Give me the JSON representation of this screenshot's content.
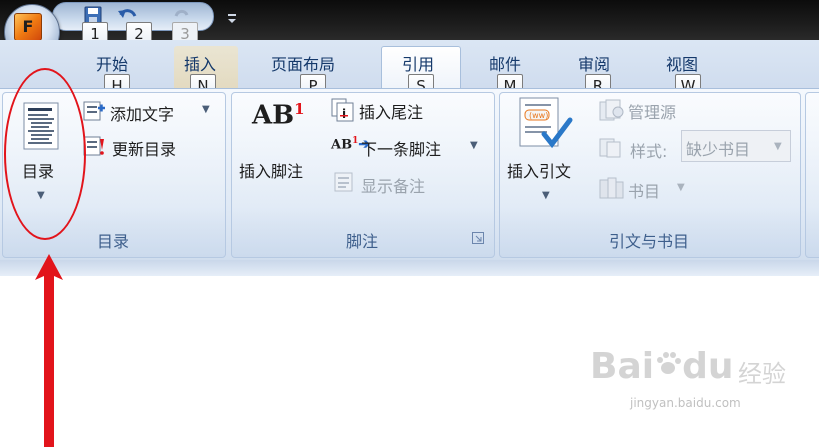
{
  "office_button": {
    "keytip": "F"
  },
  "quick_access": {
    "keytips": [
      "1",
      "2",
      "3"
    ]
  },
  "tabs": [
    {
      "label": "开始",
      "keytip": "H"
    },
    {
      "label": "插入",
      "keytip": "N"
    },
    {
      "label": "页面布局",
      "keytip": "P"
    },
    {
      "label": "引用",
      "keytip": "S",
      "active": true
    },
    {
      "label": "邮件",
      "keytip": "M"
    },
    {
      "label": "审阅",
      "keytip": "R"
    },
    {
      "label": "视图",
      "keytip": "W"
    }
  ],
  "groups": {
    "toc": {
      "label": "目录",
      "toc_button": "目录",
      "add_text": "添加文字",
      "update_toc": "更新目录"
    },
    "footnotes": {
      "label": "脚注",
      "insert_footnote": "插入脚注",
      "insert_endnote": "插入尾注",
      "next_footnote": "下一条脚注",
      "show_notes": "显示备注",
      "icon_text": "AB",
      "icon_sup": "1"
    },
    "citations": {
      "label": "引文与书目",
      "insert_citation": "插入引文",
      "manage_sources": "管理源",
      "style_label": "样式:",
      "style_value": "缺少书目",
      "bibliography": "书目"
    }
  },
  "watermark": {
    "brand": "Bai",
    "brand2": "du",
    "cn": "经验",
    "url": "jingyan.baidu.com"
  },
  "colors": {
    "annotation": "#e2141b",
    "tab_text": "#15396b",
    "group_label": "#3e5f8c"
  }
}
